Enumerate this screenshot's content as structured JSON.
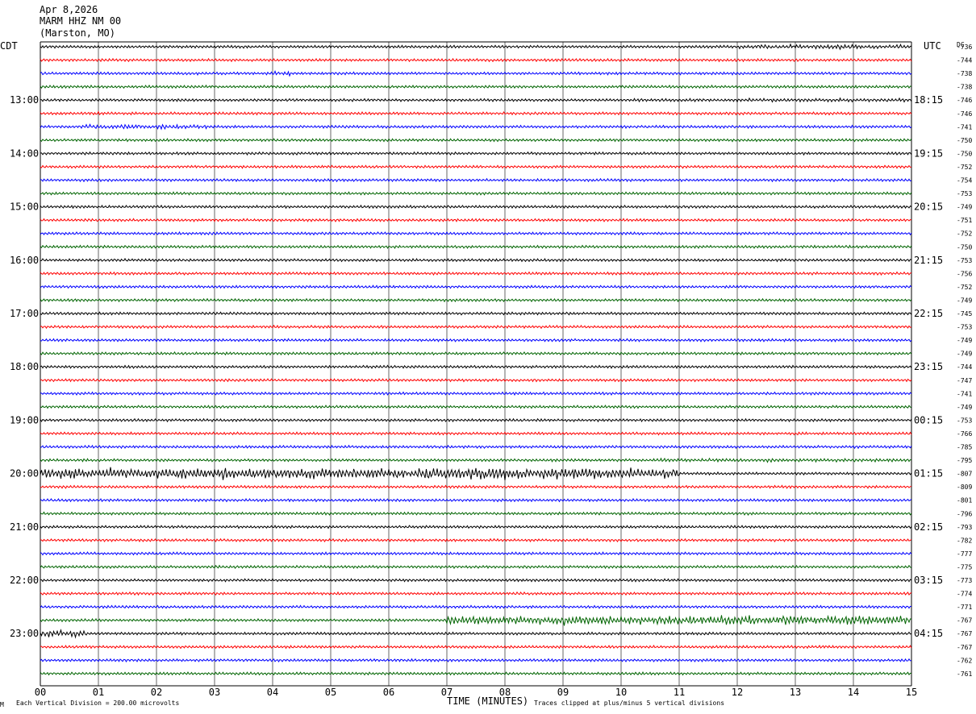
{
  "header": {
    "date": "Apr 8,2026",
    "station": "MARM HHZ NM 00",
    "location": "(Marston, MO)"
  },
  "left_zone": "CDT",
  "right_zone": "UTC",
  "dc_header": "DC",
  "footer": {
    "scale_note": "Each Vertical Division =  200.00 microvolts",
    "xlabel": "TIME (MINUTES)",
    "clip_note": "Traces clipped at plus/minus 5 vertical divisions",
    "corner_mark": "M"
  },
  "colors": {
    "cycle": [
      "#000000",
      "#ff0000",
      "#0000ff",
      "#006400"
    ],
    "grid": "#000000"
  },
  "chart_data": {
    "type": "helicorder",
    "x_ticks": [
      "00",
      "01",
      "02",
      "03",
      "04",
      "05",
      "06",
      "07",
      "08",
      "09",
      "10",
      "11",
      "12",
      "13",
      "14",
      "15"
    ],
    "xlim": [
      0,
      15
    ],
    "minutes_per_line": 15,
    "line_count": 48,
    "left_time_labels": [
      {
        "line": 4,
        "text": "13:00"
      },
      {
        "line": 8,
        "text": "14:00"
      },
      {
        "line": 12,
        "text": "15:00"
      },
      {
        "line": 16,
        "text": "16:00"
      },
      {
        "line": 20,
        "text": "17:00"
      },
      {
        "line": 24,
        "text": "18:00"
      },
      {
        "line": 28,
        "text": "19:00"
      },
      {
        "line": 32,
        "text": "20:00"
      },
      {
        "line": 36,
        "text": "21:00"
      },
      {
        "line": 40,
        "text": "22:00"
      },
      {
        "line": 44,
        "text": "23:00"
      }
    ],
    "right_time_labels": [
      {
        "line": 4,
        "text": "18:15"
      },
      {
        "line": 8,
        "text": "19:15"
      },
      {
        "line": 12,
        "text": "20:15"
      },
      {
        "line": 16,
        "text": "21:15"
      },
      {
        "line": 20,
        "text": "22:15"
      },
      {
        "line": 24,
        "text": "23:15"
      },
      {
        "line": 28,
        "text": "00:15"
      },
      {
        "line": 32,
        "text": "01:15"
      },
      {
        "line": 36,
        "text": "02:15"
      },
      {
        "line": 40,
        "text": "03:15"
      },
      {
        "line": 44,
        "text": "04:15"
      }
    ],
    "dc_offsets": [
      "-736",
      "-744",
      "-738",
      "-738",
      "-746",
      "-746",
      "-741",
      "-750",
      "-750",
      "-752",
      "-754",
      "-753",
      "-749",
      "-751",
      "-752",
      "-750",
      "-753",
      "-756",
      "-752",
      "-749",
      "-745",
      "-753",
      "-749",
      "-749",
      "-744",
      "-747",
      "-741",
      "-749",
      "-753",
      "-766",
      "-785",
      "-795",
      "-807",
      "-809",
      "-801",
      "-796",
      "-793",
      "-782",
      "-777",
      "-775",
      "-773",
      "-774",
      "-771",
      "-767",
      "-767",
      "-767",
      "-762",
      "-761"
    ],
    "bursts": [
      {
        "line": 0,
        "from_min": 12.0,
        "to_min": 15.0,
        "amp": 2.2
      },
      {
        "line": 2,
        "from_min": 4.0,
        "to_min": 4.3,
        "amp": 2.5
      },
      {
        "line": 4,
        "from_min": 10.0,
        "to_min": 15.0,
        "amp": 1.6
      },
      {
        "line": 5,
        "from_min": 0.8,
        "to_min": 1.2,
        "amp": 1.6
      },
      {
        "line": 6,
        "from_min": 0.7,
        "to_min": 3.0,
        "amp": 2.2
      },
      {
        "line": 31,
        "from_min": 10.5,
        "to_min": 15.0,
        "amp": 1.7
      },
      {
        "line": 32,
        "from_min": 0.0,
        "to_min": 11.0,
        "amp": 5.5
      },
      {
        "line": 43,
        "from_min": 7.0,
        "to_min": 15.0,
        "amp": 4.5
      },
      {
        "line": 44,
        "from_min": 0.0,
        "to_min": 0.8,
        "amp": 3.5
      }
    ]
  }
}
